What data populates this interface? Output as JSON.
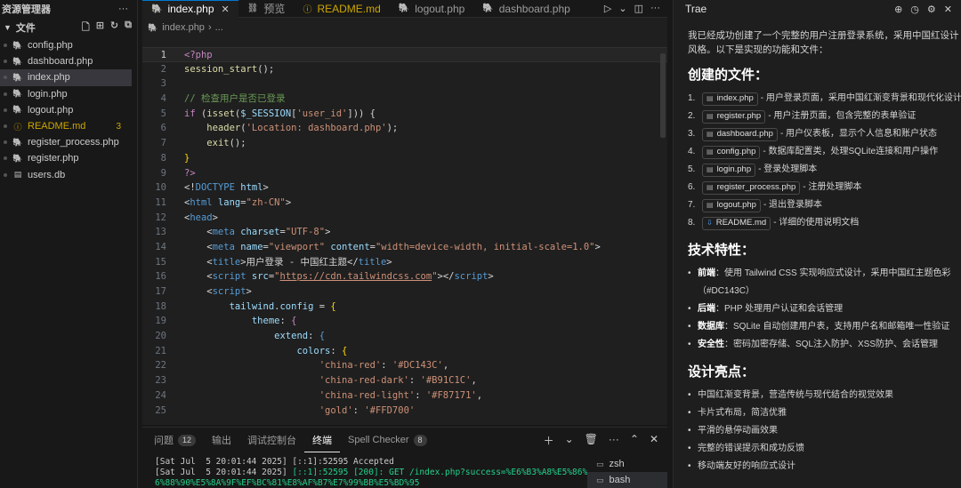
{
  "explorer": {
    "title": "资源管理器",
    "more": "···",
    "section": "文件",
    "files": [
      {
        "name": "config.php",
        "type": "php"
      },
      {
        "name": "dashboard.php",
        "type": "php"
      },
      {
        "name": "index.php",
        "type": "php",
        "active": true
      },
      {
        "name": "login.php",
        "type": "php"
      },
      {
        "name": "logout.php",
        "type": "php"
      },
      {
        "name": "README.md",
        "type": "info",
        "badge": "3"
      },
      {
        "name": "register_process.php",
        "type": "php"
      },
      {
        "name": "register.php",
        "type": "php"
      },
      {
        "name": "users.db",
        "type": "db"
      }
    ]
  },
  "tabs": [
    {
      "label": "index.php",
      "active": true
    },
    {
      "label": "预览"
    },
    {
      "label": "README.md",
      "modified": true
    },
    {
      "label": "logout.php"
    },
    {
      "label": "dashboard.php"
    }
  ],
  "breadcrumb": {
    "file": "index.php",
    "sep": "..."
  },
  "editor": {
    "current_line": 1,
    "lines": [
      [
        [
          "<?php",
          "k-purple"
        ]
      ],
      [
        [
          "session_start",
          "k-yellow"
        ],
        [
          "();",
          "k-plain"
        ]
      ],
      [],
      [
        [
          "// 检查用户是否已登录",
          "k-cmt"
        ]
      ],
      [
        [
          "if",
          "k-purple"
        ],
        [
          " (",
          "k-plain"
        ],
        [
          "isset",
          "k-yellow"
        ],
        [
          "(",
          "k-plain"
        ],
        [
          "$_SESSION",
          "k-var"
        ],
        [
          "[",
          "k-plain"
        ],
        [
          "'user_id'",
          "k-str"
        ],
        [
          "])) {",
          "k-plain"
        ]
      ],
      [
        [
          "    ",
          "k-plain"
        ],
        [
          "header",
          "k-yellow"
        ],
        [
          "(",
          "k-plain"
        ],
        [
          "'Location: dashboard.php'",
          "k-str"
        ],
        [
          ");",
          "k-plain"
        ]
      ],
      [
        [
          "    ",
          "k-plain"
        ],
        [
          "exit",
          "k-yellow"
        ],
        [
          "();",
          "k-plain"
        ]
      ],
      [
        [
          "}",
          "k-gold"
        ]
      ],
      [
        [
          "?>",
          "k-purple"
        ]
      ],
      [
        [
          "<!",
          "k-plain"
        ],
        [
          "DOCTYPE",
          "k-tag"
        ],
        [
          " html",
          "k-attr"
        ],
        [
          ">",
          "k-plain"
        ]
      ],
      [
        [
          "<",
          "k-plain"
        ],
        [
          "html",
          "k-tag"
        ],
        [
          " lang",
          "k-attr"
        ],
        [
          "=",
          "k-plain"
        ],
        [
          "\"zh-CN\"",
          "k-str"
        ],
        [
          ">",
          "k-plain"
        ]
      ],
      [
        [
          "<",
          "k-plain"
        ],
        [
          "head",
          "k-tag"
        ],
        [
          ">",
          "k-plain"
        ]
      ],
      [
        [
          "    <",
          "k-plain"
        ],
        [
          "meta",
          "k-tag"
        ],
        [
          " charset",
          "k-attr"
        ],
        [
          "=",
          "k-plain"
        ],
        [
          "\"UTF-8\"",
          "k-str"
        ],
        [
          ">",
          "k-plain"
        ]
      ],
      [
        [
          "    <",
          "k-plain"
        ],
        [
          "meta",
          "k-tag"
        ],
        [
          " name",
          "k-attr"
        ],
        [
          "=",
          "k-plain"
        ],
        [
          "\"viewport\"",
          "k-str"
        ],
        [
          " content",
          "k-attr"
        ],
        [
          "=",
          "k-plain"
        ],
        [
          "\"width=device-width, initial-scale=1.0\"",
          "k-str"
        ],
        [
          ">",
          "k-plain"
        ]
      ],
      [
        [
          "    <",
          "k-plain"
        ],
        [
          "title",
          "k-tag"
        ],
        [
          ">用户登录 - 中国红主题</",
          "k-plain"
        ],
        [
          "title",
          "k-tag"
        ],
        [
          ">",
          "k-plain"
        ]
      ],
      [
        [
          "    <",
          "k-plain"
        ],
        [
          "script",
          "k-tag"
        ],
        [
          " src",
          "k-attr"
        ],
        [
          "=",
          "k-plain"
        ],
        [
          "\"",
          "k-str"
        ],
        [
          "https://cdn.tailwindcss.com",
          "k-url"
        ],
        [
          "\"",
          "k-str"
        ],
        [
          "></",
          "k-plain"
        ],
        [
          "script",
          "k-tag"
        ],
        [
          ">",
          "k-plain"
        ]
      ],
      [
        [
          "    <",
          "k-plain"
        ],
        [
          "script",
          "k-tag"
        ],
        [
          ">",
          "k-plain"
        ]
      ],
      [
        [
          "        ",
          "k-plain"
        ],
        [
          "tailwind",
          "k-var"
        ],
        [
          ".",
          "k-plain"
        ],
        [
          "config",
          "k-var"
        ],
        [
          " = ",
          "k-plain"
        ],
        [
          "{",
          "k-gold"
        ]
      ],
      [
        [
          "            ",
          "k-plain"
        ],
        [
          "theme",
          "k-var"
        ],
        [
          ": ",
          "k-plain"
        ],
        [
          "{",
          "k-purple"
        ]
      ],
      [
        [
          "                ",
          "k-plain"
        ],
        [
          "extend",
          "k-var"
        ],
        [
          ": ",
          "k-plain"
        ],
        [
          "{",
          "k-blue"
        ]
      ],
      [
        [
          "                    ",
          "k-plain"
        ],
        [
          "colors",
          "k-var"
        ],
        [
          ": ",
          "k-plain"
        ],
        [
          "{",
          "k-gold"
        ]
      ],
      [
        [
          "                        ",
          "k-plain"
        ],
        [
          "'china-red'",
          "k-str"
        ],
        [
          ": ",
          "k-plain"
        ],
        [
          "'#DC143C'",
          "k-str"
        ],
        [
          ",",
          "k-plain"
        ]
      ],
      [
        [
          "                        ",
          "k-plain"
        ],
        [
          "'china-red-dark'",
          "k-str"
        ],
        [
          ": ",
          "k-plain"
        ],
        [
          "'#B91C1C'",
          "k-str"
        ],
        [
          ",",
          "k-plain"
        ]
      ],
      [
        [
          "                        ",
          "k-plain"
        ],
        [
          "'china-red-light'",
          "k-str"
        ],
        [
          ": ",
          "k-plain"
        ],
        [
          "'#F87171'",
          "k-str"
        ],
        [
          ",",
          "k-plain"
        ]
      ],
      [
        [
          "                        ",
          "k-plain"
        ],
        [
          "'gold'",
          "k-str"
        ],
        [
          ": ",
          "k-plain"
        ],
        [
          "'#FFD700'",
          "k-str"
        ]
      ]
    ]
  },
  "panel": {
    "tabs": [
      {
        "label": "问题",
        "badge": "12"
      },
      {
        "label": "输出"
      },
      {
        "label": "调试控制台"
      },
      {
        "label": "终端",
        "active": true
      },
      {
        "label": "Spell Checker",
        "badge": "8"
      }
    ],
    "terminal_lines": [
      [
        [
          "[Sat Jul  5 20:01:44 2025] [::1]:52595 Accepted",
          "plain"
        ]
      ],
      [
        [
          "[Sat Jul  5 20:01:44 2025] ",
          "plain"
        ],
        [
          "[::1]:52595 [200]: GET /index.php?success=%E6%B3%A8%E5%86%8C%E",
          "green"
        ]
      ],
      [
        [
          "6%88%90%E5%8A%9F%EF%BC%81%E8%AF%B7%E7%99%BB%E5%BD%95",
          "green"
        ]
      ]
    ],
    "terminals": [
      {
        "label": "zsh"
      },
      {
        "label": "bash",
        "active": true
      }
    ]
  },
  "trae": {
    "title": "Trae",
    "intro": "我已经成功创建了一个完整的用户注册登录系统，采用中国红设计风格。以下是实现的功能和文件：",
    "files_heading": "创建的文件：",
    "files": [
      {
        "chip": "index.php",
        "text": " - 用户登录页面，采用中国红渐变背景和现代化设计"
      },
      {
        "chip": "register.php",
        "text": " - 用户注册页面，包含完整的表单验证"
      },
      {
        "chip": "dashboard.php",
        "text": " - 用户仪表板，显示个人信息和账户状态"
      },
      {
        "chip": "config.php",
        "text": " - 数据库配置类，处理SQLite连接和用户操作"
      },
      {
        "chip": "login.php",
        "text": " - 登录处理脚本"
      },
      {
        "chip": "register_process.php",
        "text": " - 注册处理脚本"
      },
      {
        "chip": "logout.php",
        "text": " - 退出登录脚本"
      },
      {
        "chip": "README.md",
        "text": " - 详细的使用说明文档",
        "icon": "download"
      }
    ],
    "tech_heading": "技术特性：",
    "tech": [
      {
        "label": "前端",
        "text": "：使用 Tailwind CSS 实现响应式设计，采用中国红主题色彩（#DC143C）"
      },
      {
        "label": "后端",
        "text": "：PHP 处理用户认证和会话管理"
      },
      {
        "label": "数据库",
        "text": "：SQLite 自动创建用户表，支持用户名和邮箱唯一性验证"
      },
      {
        "label": "安全性",
        "text": "：密码加密存储、SQL注入防护、XSS防护、会话管理"
      }
    ],
    "design_heading": "设计亮点：",
    "design": [
      "中国红渐变背景，营造传统与现代结合的视觉效果",
      "卡片式布局，简洁优雅",
      "平滑的悬停动画效果",
      "完整的错误提示和成功反馈",
      "移动端友好的响应式设计"
    ]
  }
}
